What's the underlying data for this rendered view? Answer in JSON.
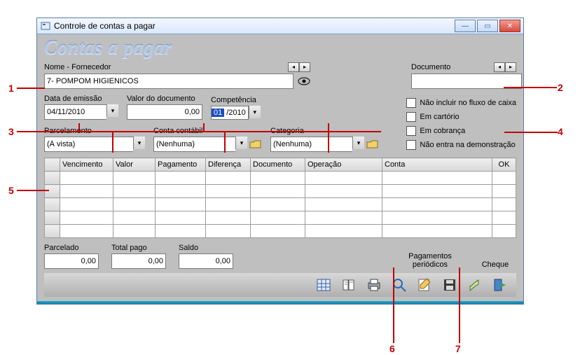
{
  "title_bar": "Controle de contas a pagar",
  "page_title": "Contas a pagar",
  "labels": {
    "nome_fornecedor": "Nome - Fornecedor",
    "documento": "Documento",
    "data_emissao": "Data de emissão",
    "valor_documento": "Valor do documento",
    "competencia": "Competência",
    "parcelamento": "Parcelamento",
    "conta_contabil": "Conta contábil",
    "categoria": "Categoria",
    "nao_fluxo": "Não incluir no fluxo de caixa",
    "em_cartorio": "Em cartório",
    "em_cobranca": "Em cobrança",
    "nao_demonstracao": "Não entra na demonstração",
    "parcelado": "Parcelado",
    "total_pago": "Total pago",
    "saldo": "Saldo",
    "pag_periodicos": "Pagamentos\nperiódicos",
    "cheque": "Cheque"
  },
  "fields": {
    "fornecedor": "7- POMPOM HIGIENICOS",
    "documento": "",
    "data_emissao": "04/11/2010",
    "valor_documento": "0,00",
    "competencia_mes": "01",
    "competencia_ano": "/2010",
    "parcelamento": "(À vista)",
    "conta_contabil": "(Nenhuma)",
    "categoria": "(Nenhuma)",
    "parcelado": "0,00",
    "total_pago": "0,00",
    "saldo": "0,00"
  },
  "grid": {
    "columns": [
      "Vencimento",
      "Valor",
      "Pagamento",
      "Diferença",
      "Documento",
      "Operação",
      "Conta",
      "OK"
    ],
    "rows": 5
  },
  "annotations": {
    "n1": "1",
    "n2": "2",
    "n3": "3",
    "n4": "4",
    "n5": "5",
    "n6": "6",
    "n7": "7"
  }
}
